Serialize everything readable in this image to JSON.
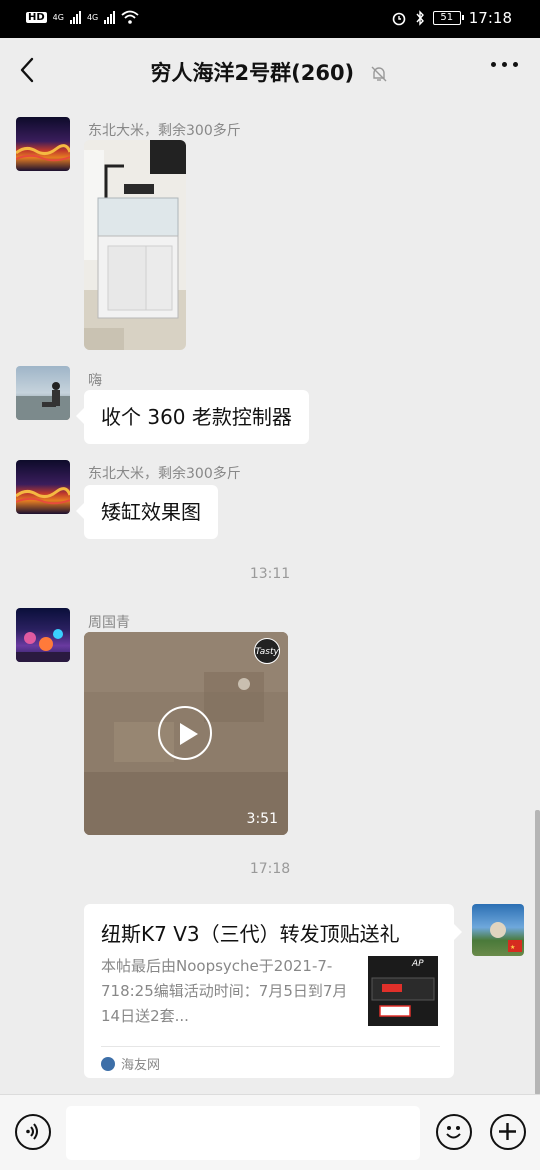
{
  "status_bar": {
    "left_labels": [
      "HD",
      "4G",
      "4G"
    ],
    "battery": "51",
    "time": "17:18"
  },
  "header": {
    "title": "穷人海洋2号群(260)"
  },
  "messages": [
    {
      "sender": "东北大米，剩余300多斤",
      "type": "image"
    },
    {
      "sender": "嗨",
      "type": "text",
      "text": "收个 360 老款控制器"
    },
    {
      "sender": "东北大米，剩余300多斤",
      "type": "text",
      "text": "矮缸效果图"
    },
    {
      "type": "timestamp",
      "text": "13:11"
    },
    {
      "sender": "周国青",
      "type": "video",
      "duration": "3:51",
      "watermark": "Tasty"
    },
    {
      "type": "timestamp",
      "text": "17:18"
    },
    {
      "type": "link_card",
      "title": "纽斯K7 V3（三代）转发顶贴送礼",
      "description": "本帖最后由Noopsyche于2021-7-718:25编辑活动时间：7月5日到7月14日送2套...",
      "source": "海友网",
      "thumb_text": "AP"
    }
  ],
  "colors": {
    "background": "#ededed",
    "bubble": "#ffffff",
    "meta_text": "#888888"
  }
}
